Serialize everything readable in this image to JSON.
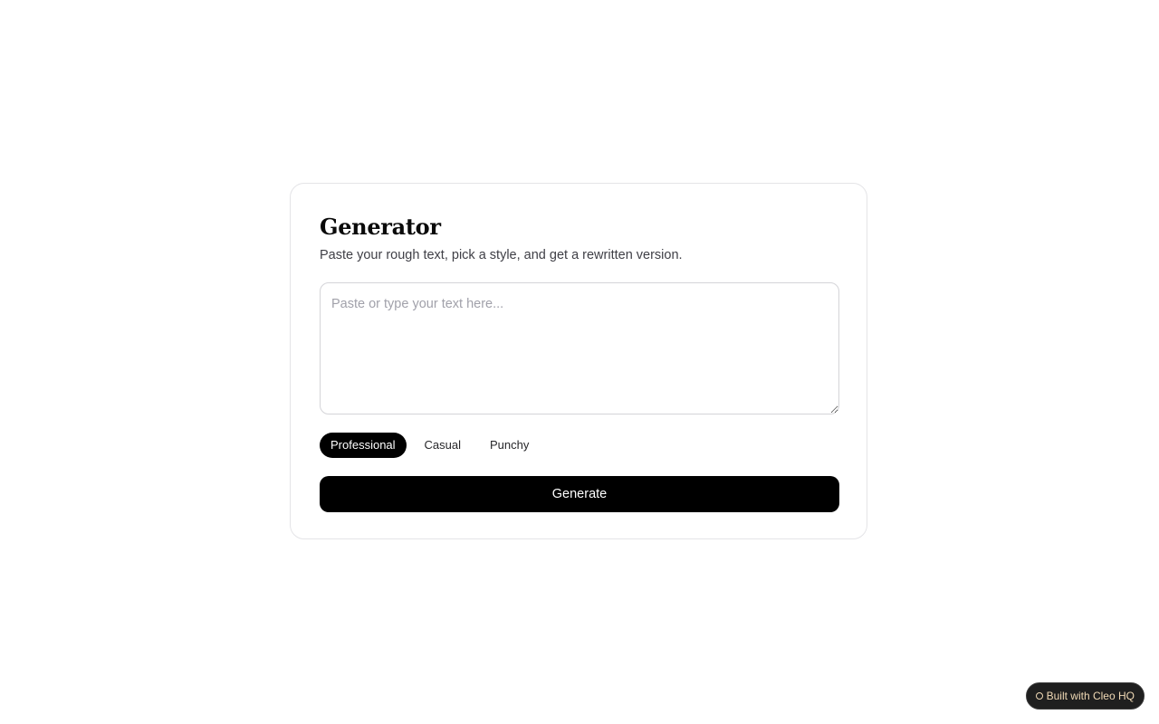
{
  "card": {
    "title": "Generator",
    "subtitle": "Paste your rough text, pick a style, and get a rewritten version."
  },
  "input": {
    "value": "",
    "placeholder": "Paste or type your text here..."
  },
  "styles": {
    "options": [
      "Professional",
      "Casual",
      "Punchy"
    ],
    "selected": "Professional"
  },
  "generate_button": {
    "label": "Generate"
  },
  "badge": {
    "label": "Built with Cleo HQ",
    "icon": "circle-icon"
  },
  "colors": {
    "accent": "#000000",
    "background": "#ffffff",
    "badge_bg": "#1f1f1f",
    "badge_text": "#f0d9b5"
  }
}
